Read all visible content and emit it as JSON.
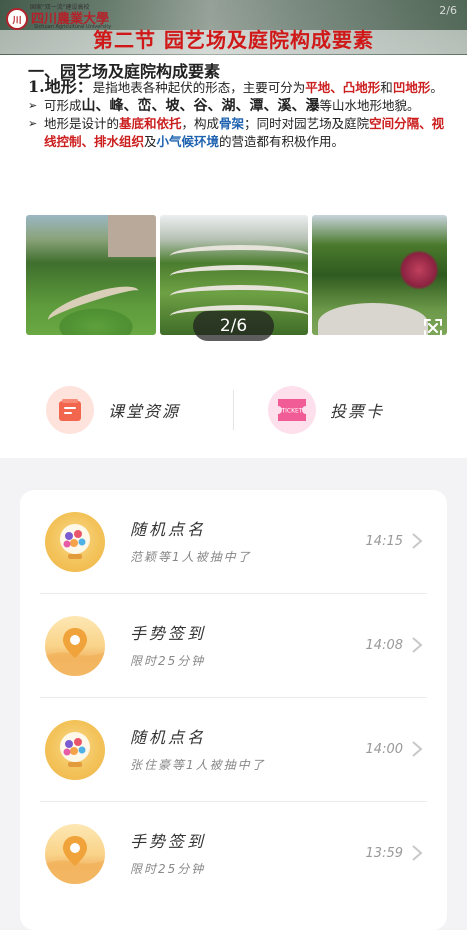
{
  "slide": {
    "page_counter": "2/6",
    "logo": {
      "name": "四川農業大學",
      "small_text": "国家\"双一流\"建设高校",
      "english": "Sichuan Agricultural University"
    },
    "title": "第二节  园艺场及庭院构成要素",
    "heading": "一、园艺场及庭院构成要素",
    "para1": {
      "prefix": "1.",
      "term": "地形",
      "colon": "：",
      "text_a": "是指地表各种起伏的形态，主要可分为",
      "k1": "平地",
      "sep1": "、",
      "k2": "凸地形",
      "and": "和",
      "k3": "凹地形",
      "end": "。"
    },
    "bullet1": {
      "text_a": "可形成",
      "k": "山、峰、峦、坡、谷、湖、潭、溪、瀑",
      "text_b": "等山水地形地貌。"
    },
    "bullet2": {
      "text_a": "地形是设计的",
      "k1": "基底和依托",
      "text_b": "，构成",
      "k2": "骨架",
      "text_c": "；同时对园艺场及庭院",
      "k3": "空间分隔、视线控制、排水组织",
      "and": "及",
      "k4": "小气候环境",
      "text_d": "的营造都有积极作用。"
    },
    "pager": "2/6"
  },
  "actions": {
    "resources_label": "课堂资源",
    "vote_label": "投票卡",
    "vote_icon_text": "TICKET"
  },
  "activities": [
    {
      "icon": "lottery-ball-icon",
      "title": "随机点名",
      "subtitle": "范颖等1人被抽中了",
      "time": "14:15"
    },
    {
      "icon": "location-pin-icon",
      "title": "手势签到",
      "subtitle": "限时25分钟",
      "time": "14:08"
    },
    {
      "icon": "lottery-ball-icon",
      "title": "随机点名",
      "subtitle": "张住豪等1人被抽中了",
      "time": "14:00"
    },
    {
      "icon": "location-pin-icon",
      "title": "手势签到",
      "subtitle": "限时25分钟",
      "time": "13:59"
    }
  ],
  "colors": {
    "title_red": "#d01818",
    "keyword_red": "#cc1f1f",
    "keyword_blue": "#1f63b0",
    "resource_accent": "#f2664e",
    "vote_accent": "#f25c96",
    "card_bg": "#ffffff"
  }
}
